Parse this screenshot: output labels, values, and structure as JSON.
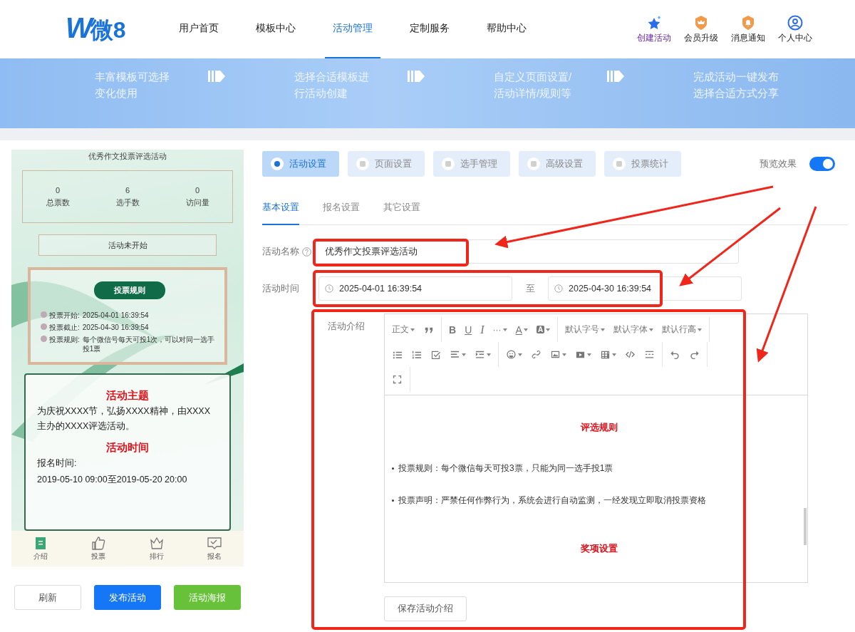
{
  "header": {
    "logo": {
      "mark": "W",
      "text": "微8"
    },
    "nav": [
      {
        "label": "用户首页",
        "selected": false
      },
      {
        "label": "模板中心",
        "selected": false
      },
      {
        "label": "活动管理",
        "selected": true
      },
      {
        "label": "定制服务",
        "selected": false
      },
      {
        "label": "帮助中心",
        "selected": false
      }
    ],
    "actions": [
      {
        "label": "创建活动",
        "kind": "star"
      },
      {
        "label": "会员升级",
        "kind": "crown"
      },
      {
        "label": "消息通知",
        "kind": "bell"
      },
      {
        "label": "个人中心",
        "kind": "user"
      }
    ]
  },
  "banner": {
    "steps": [
      {
        "lines": [
          "丰富模板可选择",
          "变化使用"
        ]
      },
      {
        "lines": [
          "选择合适模板进",
          "行活动创建"
        ]
      },
      {
        "lines": [
          "自定义页面设置/",
          "活动详情/规则等"
        ]
      },
      {
        "lines": [
          "完成活动一键发布",
          "选择合适方式分享"
        ]
      }
    ]
  },
  "preview": {
    "title": "优秀作文投票评选活动",
    "stats": [
      {
        "value": "0",
        "label": "总票数"
      },
      {
        "value": "6",
        "label": "选手数"
      },
      {
        "value": "0",
        "label": "访问量"
      }
    ],
    "status": "活动未开始",
    "rules": {
      "title": "投票规则",
      "items": [
        {
          "label": "投票开始:",
          "value": "2025-04-01 16:39:54"
        },
        {
          "label": "投票截止:",
          "value": "2025-04-30 16:39:54"
        },
        {
          "label": "投票规则:",
          "value": "每个微信号每天可投1次，可以对同一选手投1票"
        }
      ]
    },
    "intro": [
      {
        "kind": "heading",
        "text": "活动主题"
      },
      {
        "kind": "text",
        "text": "为庆祝XXXX节，弘扬XXXX精神，由XXXX主办的XXXX评选活动。"
      },
      {
        "kind": "heading",
        "text": "活动时间"
      },
      {
        "kind": "text",
        "text": "报名时间:"
      },
      {
        "kind": "text",
        "text": "2019-05-10 09:00至2019-05-20 20:00"
      }
    ],
    "tabbar": [
      {
        "label": "介绍",
        "kind": "doc",
        "selected": true
      },
      {
        "label": "投票",
        "kind": "thumb",
        "selected": false
      },
      {
        "label": "排行",
        "kind": "crown",
        "selected": false
      },
      {
        "label": "报名",
        "kind": "form",
        "selected": false
      }
    ]
  },
  "preview_buttons": [
    {
      "label": "刷新",
      "kind": "plain"
    },
    {
      "label": "发布活动",
      "kind": "primary"
    },
    {
      "label": "活动海报",
      "kind": "success"
    }
  ],
  "main_tabs": [
    {
      "label": "活动设置",
      "selected": true
    },
    {
      "label": "页面设置",
      "selected": false
    },
    {
      "label": "选手管理",
      "selected": false
    },
    {
      "label": "高级设置",
      "selected": false
    },
    {
      "label": "投票统计",
      "selected": false
    }
  ],
  "preview_toggle": {
    "label": "预览效果",
    "on": true
  },
  "sub_tabs": [
    {
      "label": "基本设置",
      "selected": true
    },
    {
      "label": "报名设置",
      "selected": false
    },
    {
      "label": "其它设置",
      "selected": false
    }
  ],
  "form": {
    "name": {
      "label": "活动名称",
      "value": "优秀作文投票评选活动"
    },
    "time": {
      "label": "活动时间",
      "start": "2025-04-01 16:39:54",
      "separator": "至",
      "end": "2025-04-30 16:39:54"
    },
    "intro": {
      "label": "活动介绍"
    }
  },
  "editor": {
    "toolbar": [
      [
        [
          {
            "kind": "text",
            "label": "正文",
            "dropdown": true
          },
          {
            "kind": "quote"
          }
        ],
        [
          {
            "kind": "bold",
            "label": "B"
          },
          {
            "kind": "underline",
            "label": "U"
          },
          {
            "kind": "italic",
            "label": "I"
          },
          {
            "kind": "text",
            "label": "···",
            "dropdown": true
          },
          {
            "kind": "fontcolor",
            "label": "A",
            "dropdown": true
          },
          {
            "kind": "bgcolor",
            "label": "A",
            "dropdown": true
          }
        ],
        [
          {
            "kind": "text",
            "label": "默认字号",
            "dropdown": true
          },
          {
            "kind": "text",
            "label": "默认字体",
            "dropdown": true
          },
          {
            "kind": "text",
            "label": "默认行高",
            "dropdown": true
          }
        ]
      ],
      [
        [
          {
            "kind": "bullets"
          },
          {
            "kind": "numbers"
          },
          {
            "kind": "todo"
          },
          {
            "kind": "align",
            "dropdown": true
          },
          {
            "kind": "indent",
            "dropdown": true
          }
        ],
        [
          {
            "kind": "emoji",
            "dropdown": true
          },
          {
            "kind": "link"
          },
          {
            "kind": "image",
            "dropdown": true
          },
          {
            "kind": "video",
            "dropdown": true
          },
          {
            "kind": "table",
            "dropdown": true
          },
          {
            "kind": "code"
          },
          {
            "kind": "divider"
          }
        ],
        [
          {
            "kind": "undo"
          },
          {
            "kind": "redo"
          }
        ]
      ],
      [
        [
          {
            "kind": "fullscreen"
          }
        ]
      ]
    ],
    "content": [
      {
        "kind": "heading",
        "text": "评选规则"
      },
      {
        "kind": "bullet",
        "text": "投票规则：每个微信每天可投3票，只能为同一选手投1票"
      },
      {
        "kind": "bullet",
        "text": "投票声明：严禁任何作弊行为，系统会进行自动监测，一经发现立即取消投票资格"
      },
      {
        "kind": "heading",
        "text": "奖项设置"
      }
    ],
    "save_button": "保存活动介绍"
  }
}
